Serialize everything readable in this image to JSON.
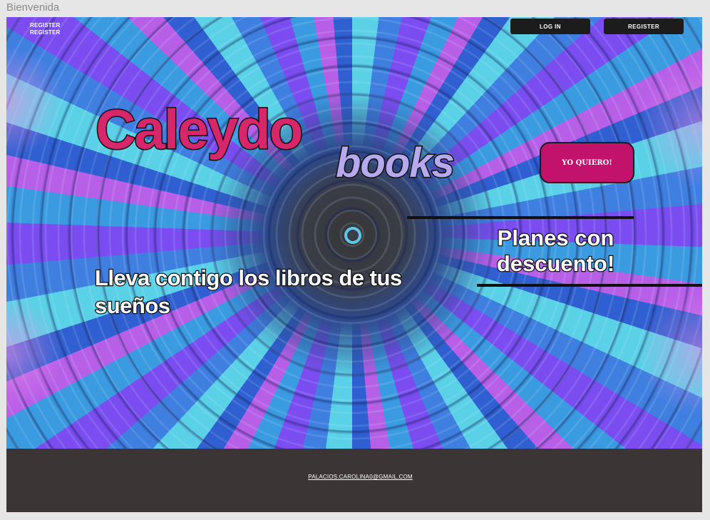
{
  "window": {
    "title": "Bienvenida"
  },
  "header": {
    "top_links": [
      "REGISTER",
      "REGISTER"
    ],
    "login_label": "LOG IN",
    "register_label": "REGISTER"
  },
  "hero": {
    "brand_main": "Caleydo",
    "brand_sub": "books",
    "cta_label": "YO QUIERO!",
    "promo_text": "Planes con descuento!",
    "tagline": "Lleva contigo los libros de tus sueños"
  },
  "footer": {
    "email": "PALACIOS.CAROLINA0@GMAIL.COM"
  },
  "colors": {
    "brand_pink": "#d8266a",
    "brand_lavender": "#b7a9f0",
    "cta_magenta": "#c2126c",
    "nav_dark": "#1c1c1c",
    "footer_bg": "#3b3535"
  },
  "background_image": "kaleidoscope-mandala"
}
